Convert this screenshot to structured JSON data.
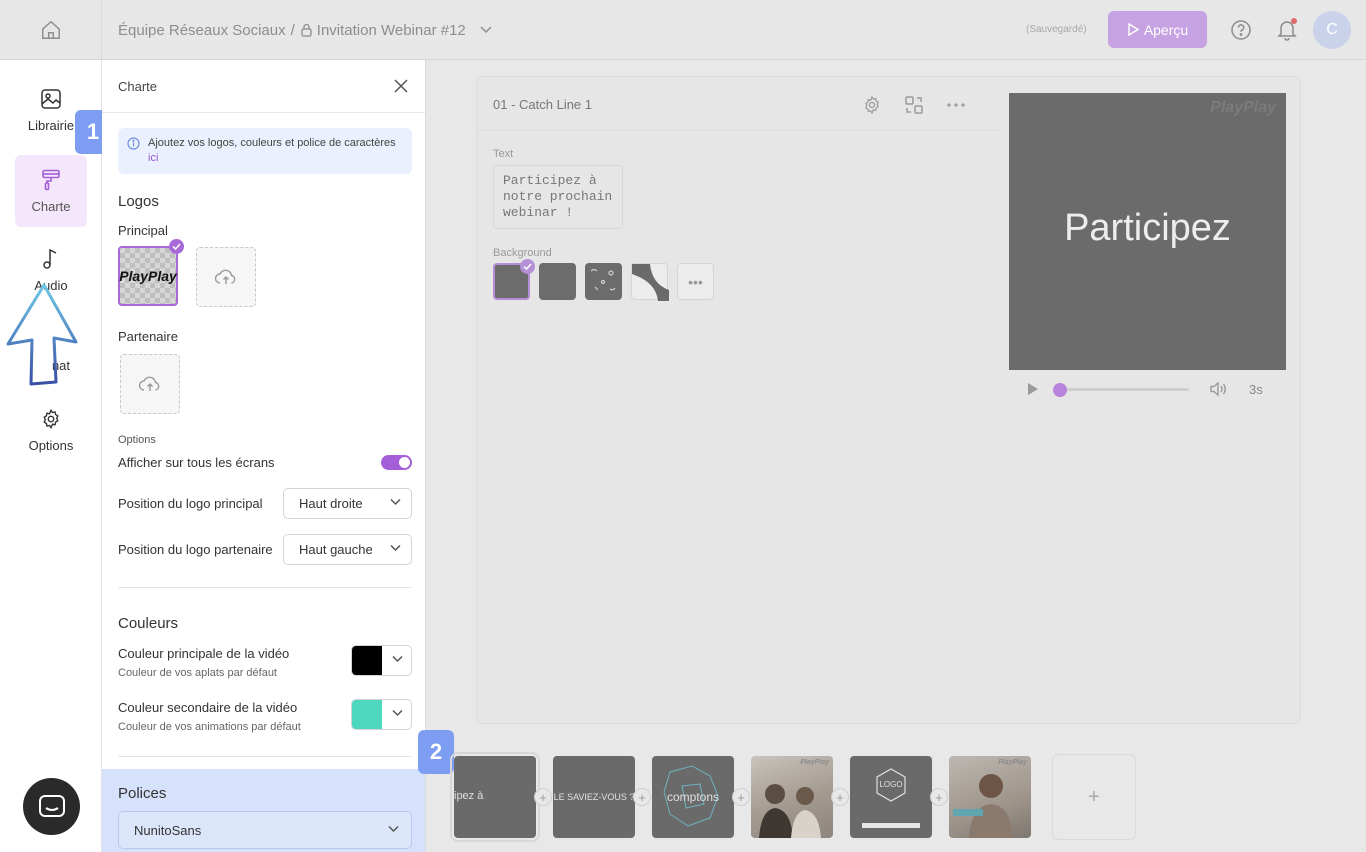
{
  "header": {
    "workspace": "Équipe Réseaux Sociaux",
    "separator": "/",
    "project": "Invitation Webinar #12",
    "saved_status": "(Sauvegardé)",
    "preview_button": "Aperçu",
    "avatar_initial": "C",
    "accent_color": "#c7a2e2"
  },
  "nav": {
    "items": [
      {
        "label": "Librairie",
        "icon": "image-icon"
      },
      {
        "label": "Charte",
        "icon": "paint-roller-icon",
        "active": true
      },
      {
        "label": "Audio",
        "icon": "music-note-icon"
      },
      {
        "label": "nat",
        "icon": "format-icon"
      },
      {
        "label": "Options",
        "icon": "gear-icon"
      }
    ],
    "step_badge_1": "1",
    "step_badge_2": "2"
  },
  "charte": {
    "title": "Charte",
    "info_text": "Ajoutez vos logos, couleurs et police de caractères",
    "info_link": "ici",
    "logos_heading": "Logos",
    "principal_label": "Principal",
    "principal_logo_text": "PlayPlay",
    "partenaire_label": "Partenaire",
    "options_label": "Options",
    "show_all_screens_label": "Afficher sur tous les écrans",
    "show_all_screens_enabled": true,
    "main_logo_position_label": "Position du logo principal",
    "main_logo_position_value": "Haut droite",
    "partner_logo_position_label": "Position du logo partenaire",
    "partner_logo_position_value": "Haut gauche",
    "colors_heading": "Couleurs",
    "primary_color_label": "Couleur principale de la vidéo",
    "primary_color_sub": "Couleur de vos aplats par défaut",
    "primary_color": "#000000",
    "secondary_color_label": "Couleur secondaire de la vidéo",
    "secondary_color_sub": "Couleur de vos animations par défaut",
    "secondary_color": "#4dd7be",
    "fonts_heading": "Polices",
    "font_value": "NunitoSans"
  },
  "editor": {
    "screen_title": "01 - Catch Line 1",
    "text_label": "Text",
    "text_value": "Participez à\nnotre prochain\nwebinar !",
    "background_label": "Background",
    "more_label": "•••",
    "preview_headline": "Participez",
    "preview_watermark": "PlayPlay",
    "duration": "3s",
    "playback_progress": 0.0
  },
  "timeline": {
    "thumbs": [
      {
        "text": "ipez à",
        "type": "grey",
        "selected": true
      },
      {
        "text": "LE SAVIEZ-VOUS ?",
        "type": "grey"
      },
      {
        "text": "comptons",
        "type": "map"
      },
      {
        "text": "",
        "type": "photo",
        "wm": "PlayPlay"
      },
      {
        "text": "LOGO",
        "type": "logo"
      },
      {
        "text": "",
        "type": "photo2",
        "wm": "PlayPlay"
      }
    ],
    "plus_label": "+",
    "add_label": "+"
  }
}
